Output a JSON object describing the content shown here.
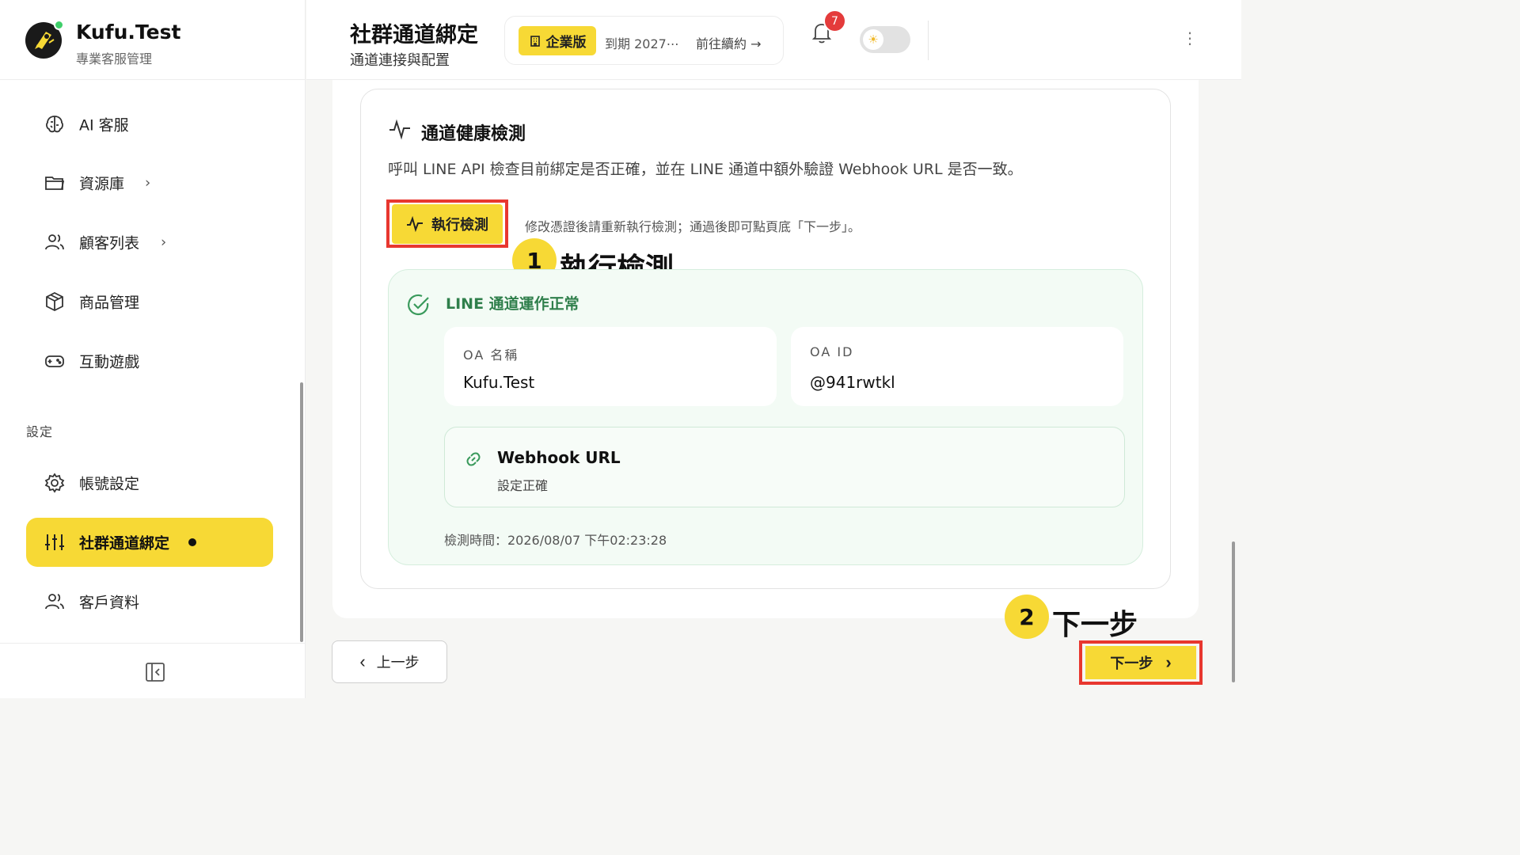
{
  "brand": {
    "name": "Kufu.Test",
    "subtitle": "專業客服管理"
  },
  "sidebar": {
    "items": [
      {
        "label": "AI 客服",
        "icon": "brain-icon",
        "has_chevron": false
      },
      {
        "label": "資源庫",
        "icon": "folder-icon",
        "has_chevron": true
      },
      {
        "label": "顧客列表",
        "icon": "users-icon",
        "has_chevron": true
      },
      {
        "label": "商品管理",
        "icon": "box-icon",
        "has_chevron": false
      },
      {
        "label": "互動遊戲",
        "icon": "gamepad-icon",
        "has_chevron": false
      }
    ],
    "section_label": "設定",
    "settings_items": [
      {
        "label": "帳號設定",
        "icon": "gear-icon"
      },
      {
        "label": "社群通道綁定",
        "icon": "sliders-icon",
        "active": true
      },
      {
        "label": "客戶資料",
        "icon": "users-icon"
      }
    ],
    "chevron": "›"
  },
  "header": {
    "title": "社群通道綁定",
    "subtitle": "通道連接與配置",
    "plan": {
      "badge": "企業版",
      "expire": "到期 2027⋯",
      "renew": "前往續約 →"
    },
    "notification_count": "7",
    "theme_icon": "☀",
    "more_icon": "⋮"
  },
  "health": {
    "title": "通道健康檢測",
    "description": "呼叫 LINE API 檢查目前綁定是否正確，並在 LINE 通道中額外驗證 Webhook URL 是否一致。",
    "run_button": "執行檢測",
    "hint": "修改憑證後請重新執行檢測；通過後即可點頁底「下一步」。",
    "status_title": "LINE 通道運作正常",
    "oa_name_label": "OA 名稱",
    "oa_name_value": "Kufu.Test",
    "oa_id_label": "OA ID",
    "oa_id_value": "@941rwtkl",
    "webhook_title": "Webhook URL",
    "webhook_status": "設定正確",
    "checked_at": "檢測時間：2026/08/07 下午02:23:28"
  },
  "annotations": {
    "step1": {
      "number": "1",
      "text": "執行檢測"
    },
    "step2": {
      "number": "2",
      "text": "下一步"
    }
  },
  "footer": {
    "prev_label": "上一步",
    "next_label": "下一步"
  },
  "colors": {
    "accent": "#f7d935",
    "highlight": "#e8372f",
    "success": "#2f7f4b"
  }
}
